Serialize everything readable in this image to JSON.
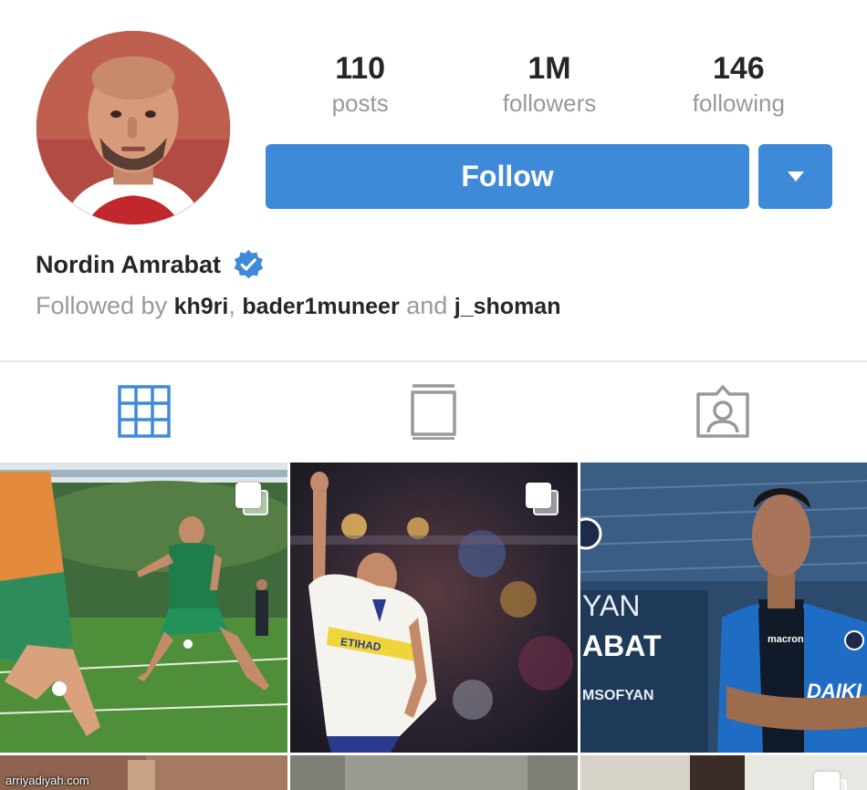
{
  "profile": {
    "name": "Nordin Amrabat",
    "verified": true,
    "avatar_icon": "profile-photo"
  },
  "stats": [
    {
      "value": "110",
      "label": "posts"
    },
    {
      "value": "1M",
      "label": "followers"
    },
    {
      "value": "146",
      "label": "following"
    }
  ],
  "actions": {
    "follow_label": "Follow",
    "dropdown_icon": "caret-down-icon"
  },
  "followed_by": {
    "prefix": "Followed by",
    "users": [
      "kh9ri",
      "bader1muneer",
      "j_shoman"
    ],
    "separator": ",",
    "conjunction": "and"
  },
  "tabs": [
    {
      "name": "grid",
      "icon": "grid-icon",
      "active": true
    },
    {
      "name": "feed",
      "icon": "feed-icon",
      "active": false
    },
    {
      "name": "tagged",
      "icon": "tagged-icon",
      "active": false
    }
  ],
  "posts": [
    {
      "id": 1,
      "description": "training",
      "multi": true
    },
    {
      "id": 2,
      "description": "celebration",
      "multi": true,
      "shirt_text": "ETIHAD"
    },
    {
      "id": 3,
      "description": "club",
      "multi": false,
      "overlay_lines": [
        "YAN",
        "ABAT",
        "MSOFYAN"
      ],
      "shirt_text": "DAIKI",
      "sponsor": "macron"
    },
    {
      "id": 4,
      "description": "post",
      "multi": false
    },
    {
      "id": 5,
      "description": "post",
      "multi": false
    },
    {
      "id": 6,
      "description": "post",
      "multi": true
    }
  ],
  "watermark": "arriyadiyah.com",
  "colors": {
    "accent": "#3f8ad8",
    "text": "#262626",
    "muted": "#999999",
    "verified": "#3f8ad8"
  }
}
